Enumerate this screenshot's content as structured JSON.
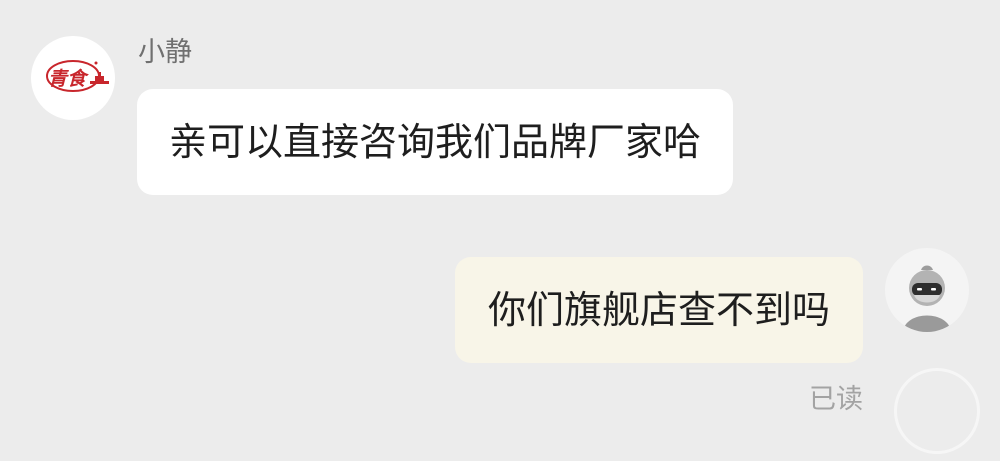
{
  "incoming": {
    "sender_name": "小静",
    "avatar_logo_text": "青食",
    "message": "亲可以直接咨询我们品牌厂家哈"
  },
  "outgoing": {
    "message": "你们旗舰店查不到吗",
    "status": "已读"
  },
  "colors": {
    "background": "#ececec",
    "incoming_bubble": "#ffffff",
    "outgoing_bubble": "#f8f5e8",
    "logo_red": "#c8262c"
  }
}
